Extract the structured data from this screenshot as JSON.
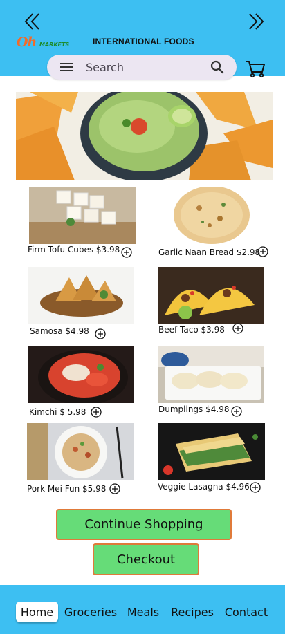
{
  "header": {
    "logo": {
      "oh": "Oh",
      "markets": "MARKETS"
    },
    "title": "INTERNATIONAL FOODS",
    "back_icon": "double-chevron-left-icon",
    "forward_icon": "double-chevron-right-icon"
  },
  "search": {
    "placeholder": "Search",
    "menu_icon": "hamburger-menu-icon",
    "search_icon": "magnifier-icon",
    "cart_icon": "shopping-cart-icon"
  },
  "hero": {
    "image": "guacamole bowl with tortilla chips"
  },
  "products": [
    {
      "label": "Firm Tofu Cubes $3.98",
      "image": "tofu cubes on board"
    },
    {
      "label": "Garlic Naan Bread $2.98",
      "image": "naan bread"
    },
    {
      "label": "Samosa $4.98",
      "image": "samosas in basket"
    },
    {
      "label": "Beef Taco $3.98",
      "image": "beef tacos"
    },
    {
      "label": "Kimchi $ 5.98",
      "image": "kimchi bowl"
    },
    {
      "label": "Dumplings $4.98",
      "image": "dumplings on plate"
    },
    {
      "label": "Pork Mei Fun $5.98",
      "image": "pork mei fun noodles"
    },
    {
      "label": "Veggie Lasagna $4.96",
      "image": "veggie lasagna"
    }
  ],
  "actions": {
    "continue_label": "Continue Shopping",
    "checkout_label": "Checkout"
  },
  "nav": {
    "items": [
      "Home",
      "Groceries",
      "Meals",
      "Recipes",
      "Contact"
    ],
    "active": "Home"
  },
  "colors": {
    "header_bg": "#3dbff2",
    "button_bg": "#66dc78",
    "button_border": "#e07a3a",
    "search_bg": "#ece6f2"
  }
}
